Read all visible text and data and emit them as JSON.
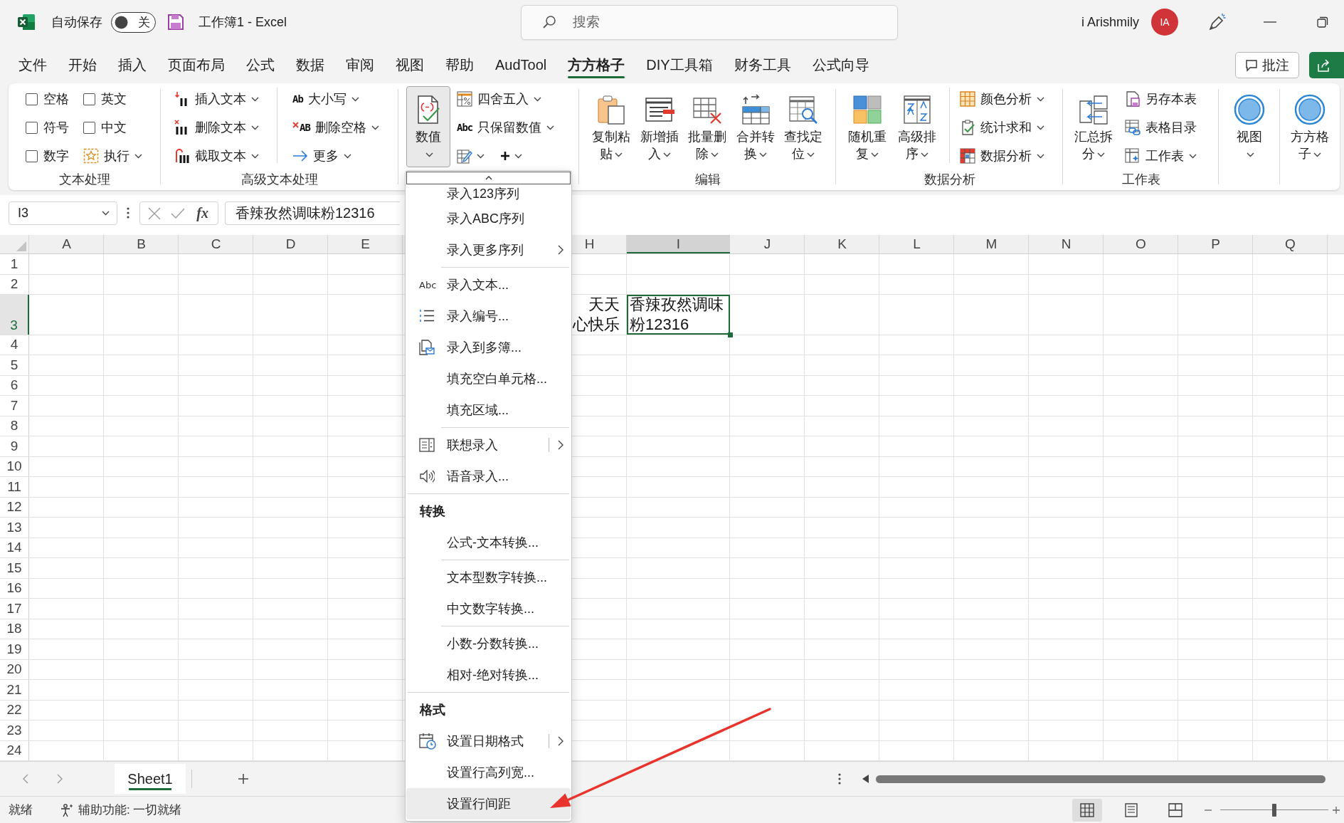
{
  "title_bar": {
    "autosave_label": "自动保存",
    "autosave": {
      "on": false,
      "label": "关"
    },
    "document_title": "工作簿1 - Excel",
    "search": {
      "placeholder": "搜索"
    },
    "user_name": "i Arishmily",
    "avatar_initials": "IA"
  },
  "ribbon_tabs": [
    {
      "label": "文件",
      "selected": false
    },
    {
      "label": "开始",
      "selected": false
    },
    {
      "label": "插入",
      "selected": false
    },
    {
      "label": "页面布局",
      "selected": false
    },
    {
      "label": "公式",
      "selected": false
    },
    {
      "label": "数据",
      "selected": false
    },
    {
      "label": "审阅",
      "selected": false
    },
    {
      "label": "视图",
      "selected": false
    },
    {
      "label": "帮助",
      "selected": false
    },
    {
      "label": "AudTool",
      "selected": false
    },
    {
      "label": "方方格子",
      "selected": true
    },
    {
      "label": "DIY工具箱",
      "selected": false
    },
    {
      "label": "财务工具",
      "selected": false
    },
    {
      "label": "公式向导",
      "selected": false
    }
  ],
  "comment_button": {
    "label": "批注"
  },
  "ribbon": {
    "groups": [
      {
        "label": "文本处理",
        "columns": [
          {
            "kind": "stack",
            "items": [
              {
                "kind": "checkbox",
                "label": "空格",
                "checked": false
              },
              {
                "kind": "checkbox",
                "label": "符号",
                "checked": false
              },
              {
                "kind": "checkbox",
                "label": "数字",
                "checked": false
              }
            ]
          },
          {
            "kind": "stack",
            "items": [
              {
                "kind": "checkbox",
                "label": "英文",
                "checked": false
              },
              {
                "kind": "checkbox",
                "label": "中文",
                "checked": false
              },
              {
                "kind": "button",
                "label": "执行",
                "dropdown": true
              }
            ]
          }
        ]
      },
      {
        "label": "高级文本处理",
        "columns": [
          {
            "kind": "stack",
            "items": [
              {
                "kind": "button",
                "label": "插入文本",
                "dropdown": true
              },
              {
                "kind": "button",
                "label": "删除文本",
                "dropdown": true
              },
              {
                "kind": "button",
                "label": "截取文本",
                "dropdown": true
              }
            ]
          },
          {
            "kind": "divider"
          },
          {
            "kind": "stack",
            "items": [
              {
                "kind": "button",
                "icon_text": "Ab",
                "label": "大小写",
                "dropdown": true
              },
              {
                "kind": "button",
                "icon_text": "AB",
                "label": "删除空格",
                "dropdown": true
              },
              {
                "kind": "button",
                "label": "更多",
                "dropdown": true
              }
            ]
          }
        ]
      },
      {
        "columns": [
          {
            "kind": "large",
            "label": "数值",
            "dropdown": true,
            "pressed": true
          },
          {
            "kind": "stack",
            "items": [
              {
                "kind": "button",
                "label": "四舍五入",
                "dropdown": true
              },
              {
                "kind": "button",
                "icon_text": "Abc",
                "label": "只保留数值",
                "dropdown": true
              },
              {
                "kind": "icons",
                "buttons": [
                  {
                    "dropdown": true
                  },
                  {
                    "dropdown": true
                  }
                ]
              }
            ]
          }
        ]
      },
      {
        "label": "编辑",
        "columns": [
          {
            "kind": "large",
            "label": "复制粘贴",
            "dropdown": true,
            "pressed": false
          },
          {
            "kind": "large",
            "label": "新增插入",
            "dropdown": true,
            "pressed": false
          },
          {
            "kind": "large",
            "label": "批量删除",
            "dropdown": true,
            "pressed": false
          },
          {
            "kind": "large",
            "label": "合并转换",
            "dropdown": true,
            "pressed": false
          },
          {
            "kind": "large",
            "label": "查找定位",
            "dropdown": true,
            "pressed": false
          }
        ]
      },
      {
        "label": "数据分析",
        "columns": [
          {
            "kind": "large",
            "label": "随机重复",
            "dropdown": true,
            "pressed": false
          },
          {
            "kind": "large",
            "label": "高级排序",
            "dropdown": true,
            "pressed": false
          },
          {
            "kind": "divider"
          },
          {
            "kind": "stack",
            "items": [
              {
                "kind": "button",
                "label": "颜色分析",
                "dropdown": true
              },
              {
                "kind": "button",
                "label": "统计求和",
                "dropdown": true
              },
              {
                "kind": "button",
                "label": "数据分析",
                "dropdown": true
              }
            ]
          }
        ]
      },
      {
        "label": "工作表",
        "columns": [
          {
            "kind": "large",
            "label": "汇总拆分",
            "dropdown": true,
            "pressed": false
          },
          {
            "kind": "stack",
            "items": [
              {
                "kind": "button",
                "label": "另存本表",
                "dropdown": false
              },
              {
                "kind": "button",
                "label": "表格目录",
                "dropdown": false
              },
              {
                "kind": "button",
                "label": "工作表",
                "dropdown": true
              }
            ]
          }
        ]
      },
      {
        "columns": [
          {
            "kind": "large",
            "label": "视图",
            "dropdown": true,
            "pressed": false
          }
        ]
      },
      {
        "columns": [
          {
            "kind": "large",
            "label": "方方格子",
            "dropdown": true,
            "pressed": false
          }
        ]
      }
    ]
  },
  "formula_bar": {
    "name_box": "I3",
    "fx_label": "fx",
    "formula": "香辣孜然调味粉12316"
  },
  "dropdown_menu": {
    "sections": [
      {
        "groups": [
          [
            {
              "label": "录入123序列",
              "kind": "plain",
              "highlighted": false
            },
            {
              "label": "录入ABC序列",
              "kind": "plain",
              "highlighted": false
            },
            {
              "label": "录入更多序列",
              "kind": "submenu",
              "highlighted": false
            }
          ],
          [
            {
              "label": "录入文本...",
              "icon_text": "Abc",
              "kind": "plain",
              "highlighted": false
            },
            {
              "label": "录入编号...",
              "kind": "plain",
              "highlighted": false
            },
            {
              "label": "录入到多簿...",
              "kind": "plain",
              "highlighted": false
            },
            {
              "label": "填充空白单元格...",
              "kind": "plain",
              "highlighted": false
            },
            {
              "label": "填充区域...",
              "kind": "plain",
              "highlighted": false
            }
          ],
          [
            {
              "label": "联想录入",
              "kind": "split",
              "highlighted": false
            },
            {
              "label": "语音录入...",
              "kind": "plain",
              "highlighted": false
            }
          ]
        ]
      },
      {
        "header": "转换",
        "groups": [
          [
            {
              "label": "公式-文本转换...",
              "kind": "plain",
              "highlighted": false
            }
          ],
          [
            {
              "label": "文本型数字转换...",
              "kind": "plain",
              "highlighted": false
            },
            {
              "label": "中文数字转换...",
              "kind": "plain",
              "highlighted": false
            }
          ],
          [
            {
              "label": "小数-分数转换...",
              "kind": "plain",
              "highlighted": false
            },
            {
              "label": "相对-绝对转换...",
              "kind": "plain",
              "highlighted": false
            }
          ]
        ]
      },
      {
        "header": "格式",
        "groups": [
          [
            {
              "label": "设置日期格式",
              "kind": "split",
              "highlighted": false
            },
            {
              "label": "设置行高列宽...",
              "kind": "plain",
              "highlighted": false
            },
            {
              "label": "设置行间距",
              "kind": "plain",
              "highlighted": true
            }
          ]
        ]
      }
    ]
  },
  "grid": {
    "columns": [
      {
        "label": "A",
        "selected": false
      },
      {
        "label": "B",
        "selected": false
      },
      {
        "label": "C",
        "selected": false
      },
      {
        "label": "D",
        "selected": false
      },
      {
        "label": "E",
        "selected": false
      },
      {
        "label": "H",
        "selected": false
      },
      {
        "label": "I",
        "selected": true
      },
      {
        "label": "J",
        "selected": false
      },
      {
        "label": "K",
        "selected": false
      },
      {
        "label": "L",
        "selected": false
      },
      {
        "label": "M",
        "selected": false
      },
      {
        "label": "N",
        "selected": false
      },
      {
        "label": "O",
        "selected": false
      },
      {
        "label": "P",
        "selected": false
      },
      {
        "label": "Q",
        "selected": false
      }
    ],
    "rows": [
      {
        "label": "1",
        "selected": false
      },
      {
        "label": "2",
        "selected": false
      },
      {
        "label": "3",
        "selected": true,
        "cells": [
          {
            "text": "天天心快乐",
            "selected": false
          },
          {
            "text": "香辣孜然调味粉12316",
            "selected": true
          }
        ]
      },
      {
        "label": "4",
        "selected": false
      },
      {
        "label": "5",
        "selected": false
      },
      {
        "label": "6",
        "selected": false
      },
      {
        "label": "7",
        "selected": false
      },
      {
        "label": "8",
        "selected": false
      },
      {
        "label": "9",
        "selected": false
      },
      {
        "label": "10",
        "selected": false
      },
      {
        "label": "11",
        "selected": false
      },
      {
        "label": "12",
        "selected": false
      },
      {
        "label": "13",
        "selected": false
      },
      {
        "label": "14",
        "selected": false
      },
      {
        "label": "15",
        "selected": false
      },
      {
        "label": "16",
        "selected": false
      },
      {
        "label": "17",
        "selected": false
      },
      {
        "label": "18",
        "selected": false
      },
      {
        "label": "19",
        "selected": false
      },
      {
        "label": "20",
        "selected": false
      },
      {
        "label": "21",
        "selected": false
      },
      {
        "label": "22",
        "selected": false
      },
      {
        "label": "23",
        "selected": false
      },
      {
        "label": "24",
        "selected": false
      }
    ]
  },
  "sheet_tabs": [
    {
      "label": "Sheet1",
      "selected": true
    }
  ],
  "status_bar": {
    "ready": "就绪",
    "accessibility": "辅助功能: 一切就绪",
    "view_modes": [
      {
        "selected": true
      },
      {
        "selected": false
      },
      {
        "selected": false
      }
    ],
    "zoom": {
      "level": 0.5
    }
  }
}
